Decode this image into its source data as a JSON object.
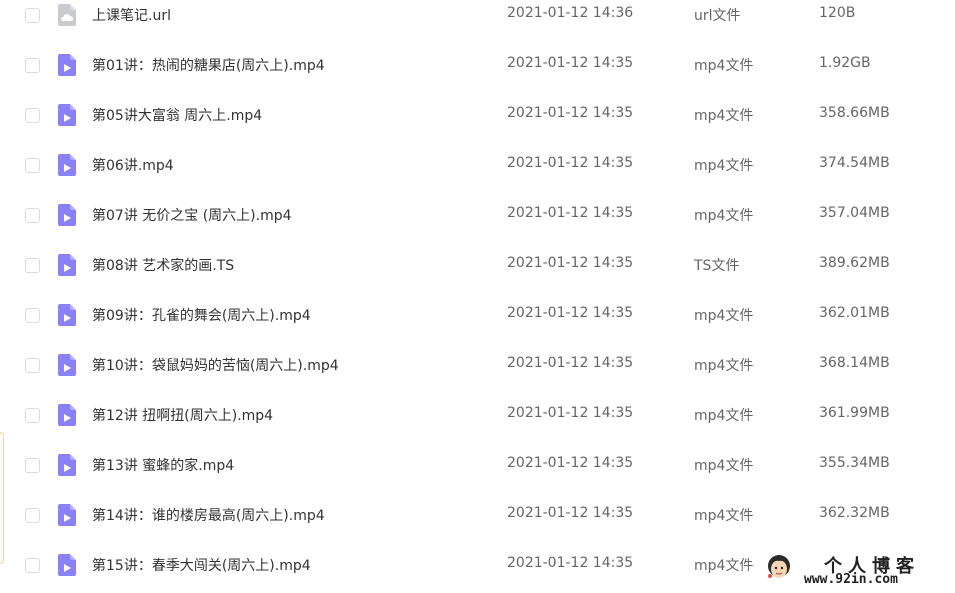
{
  "files": [
    {
      "name": "上课笔记.url",
      "date": "2021-01-12 14:36",
      "type": "url文件",
      "size": "120B",
      "icon": "cloud-file-icon"
    },
    {
      "name": "第01讲：热闹的糖果店(周六上).mp4",
      "date": "2021-01-12 14:35",
      "type": "mp4文件",
      "size": "1.92GB",
      "icon": "video-file-icon"
    },
    {
      "name": "第05讲大富翁 周六上.mp4",
      "date": "2021-01-12 14:35",
      "type": "mp4文件",
      "size": "358.66MB",
      "icon": "video-file-icon"
    },
    {
      "name": "第06讲.mp4",
      "date": "2021-01-12 14:35",
      "type": "mp4文件",
      "size": "374.54MB",
      "icon": "video-file-icon"
    },
    {
      "name": "第07讲 无价之宝 (周六上).mp4",
      "date": "2021-01-12 14:35",
      "type": "mp4文件",
      "size": "357.04MB",
      "icon": "video-file-icon"
    },
    {
      "name": "第08讲 艺术家的画.TS",
      "date": "2021-01-12 14:35",
      "type": "TS文件",
      "size": "389.62MB",
      "icon": "video-file-icon"
    },
    {
      "name": "第09讲：孔雀的舞会(周六上).mp4",
      "date": "2021-01-12 14:35",
      "type": "mp4文件",
      "size": "362.01MB",
      "icon": "video-file-icon"
    },
    {
      "name": "第10讲：袋鼠妈妈的苦恼(周六上).mp4",
      "date": "2021-01-12 14:35",
      "type": "mp4文件",
      "size": "368.14MB",
      "icon": "video-file-icon"
    },
    {
      "name": "第12讲  扭啊扭(周六上).mp4",
      "date": "2021-01-12 14:35",
      "type": "mp4文件",
      "size": "361.99MB",
      "icon": "video-file-icon"
    },
    {
      "name": "第13讲 蜜蜂的家.mp4",
      "date": "2021-01-12 14:35",
      "type": "mp4文件",
      "size": "355.34MB",
      "icon": "video-file-icon"
    },
    {
      "name": "第14讲：谁的楼房最高(周六上).mp4",
      "date": "2021-01-12 14:35",
      "type": "mp4文件",
      "size": "362.32MB",
      "icon": "video-file-icon"
    },
    {
      "name": "第15讲：春季大闯关(周六上).mp4",
      "date": "2021-01-12 14:35",
      "type": "mp4文件",
      "size": "",
      "icon": "video-file-icon"
    }
  ],
  "watermark": {
    "title": "个人博客",
    "url": "www.92in.com"
  },
  "colors": {
    "video_icon": "#8b80f5",
    "cloud_icon": "#c9cbd1",
    "text": "#333333",
    "meta_text": "#666666"
  }
}
